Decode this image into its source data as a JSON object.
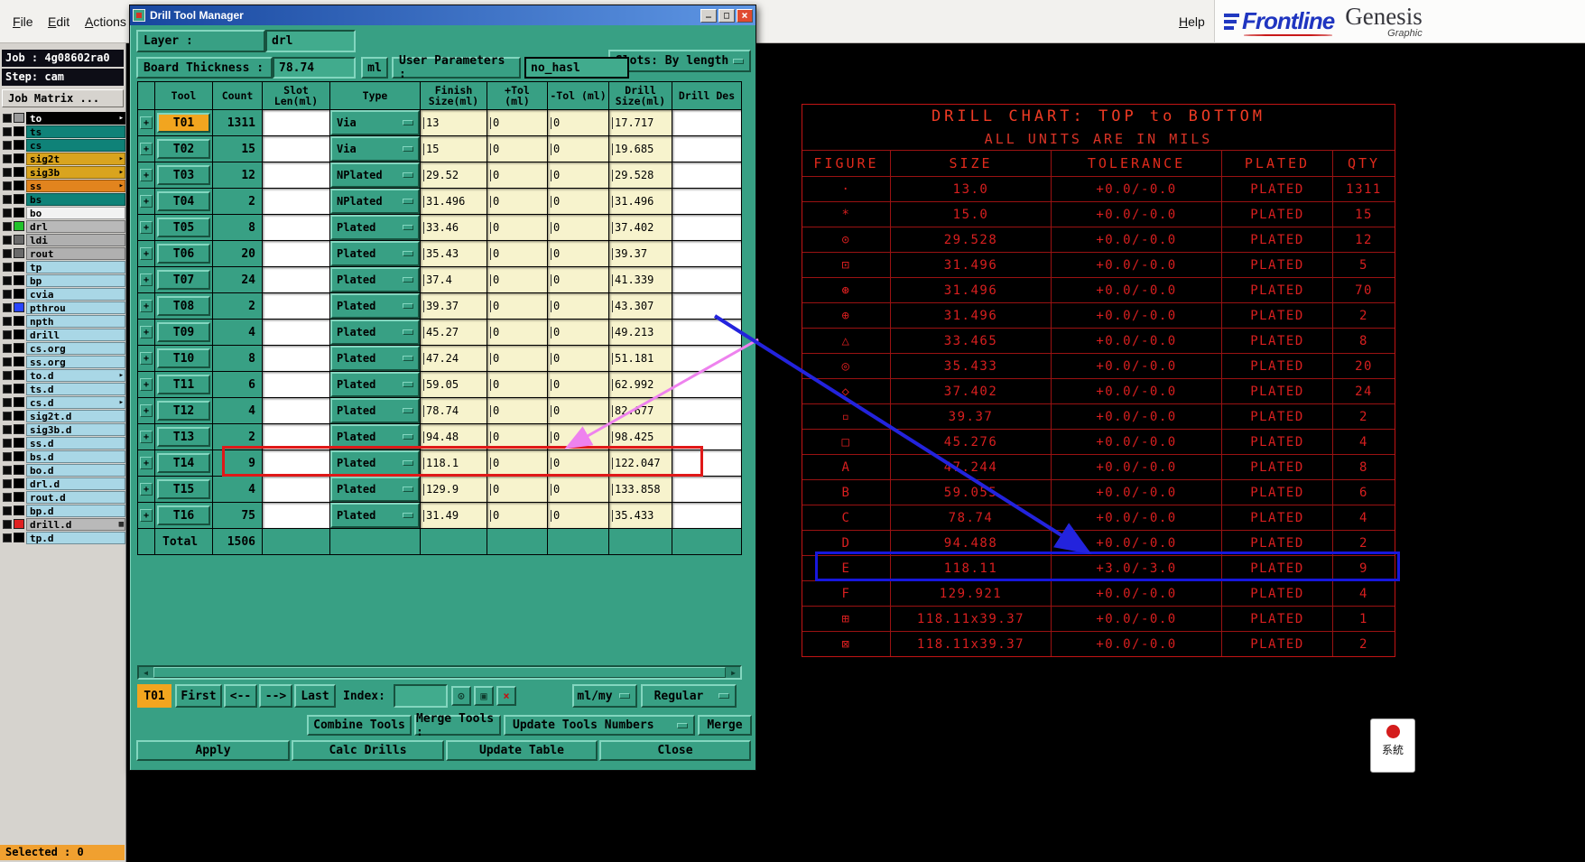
{
  "menubar": {
    "items": [
      "File",
      "Edit",
      "Actions"
    ],
    "help": "Help"
  },
  "logo": {
    "brand": "Frontline",
    "product": "Genesis",
    "subtitle": "Graphic"
  },
  "sidebar": {
    "job_label": "Job : 4g08602ra0",
    "step_label": "Step: cam",
    "job_matrix_button": "Job Matrix ...",
    "selected_label": "Selected : 0",
    "layers": [
      {
        "name": "to",
        "bg": "#000000",
        "fg": "#ffffff",
        "swatch": "#9a9a9a",
        "arrow": true
      },
      {
        "name": "ts",
        "bg": "#0f8278",
        "swatch": "#000000"
      },
      {
        "name": "cs",
        "bg": "#0f8278",
        "swatch": "#000000"
      },
      {
        "name": "sig2t",
        "bg": "#d9a41e",
        "swatch": "#000000",
        "arrow": true
      },
      {
        "name": "sig3b",
        "bg": "#d9a41e",
        "swatch": "#000000",
        "arrow": true
      },
      {
        "name": "ss",
        "bg": "#e2841e",
        "swatch": "#000000",
        "arrow": true
      },
      {
        "name": "bs",
        "bg": "#0f8278",
        "swatch": "#000000"
      },
      {
        "name": "bo",
        "bg": "#f2f2f2",
        "swatch": "#000000"
      },
      {
        "name": "drl",
        "bg": "#b9b9b9",
        "swatch": "#21c22b"
      },
      {
        "name": "ldi",
        "bg": "#b0b0b0",
        "swatch": "#6a6a6a"
      },
      {
        "name": "rout",
        "bg": "#b0b0b0",
        "swatch": "#6a6a6a"
      },
      {
        "name": "tp",
        "bg": "#a9d7e6",
        "swatch": "#000000"
      },
      {
        "name": "bp",
        "bg": "#a9d7e6",
        "swatch": "#000000"
      },
      {
        "name": "cvia",
        "bg": "#a9d7e6",
        "swatch": "#000000"
      },
      {
        "name": "pthrou",
        "bg": "#a9d7e6",
        "swatch": "#2945ff"
      },
      {
        "name": "npth",
        "bg": "#a9d7e6",
        "swatch": "#000000"
      },
      {
        "name": "drill",
        "bg": "#a9d7e6",
        "swatch": "#000000"
      },
      {
        "name": "cs.org",
        "bg": "#a9d7e6",
        "swatch": "#000000"
      },
      {
        "name": "ss.org",
        "bg": "#a9d7e6",
        "swatch": "#000000"
      },
      {
        "name": "to.d",
        "bg": "#a9d7e6",
        "swatch": "#000000",
        "arrow": true
      },
      {
        "name": "ts.d",
        "bg": "#a9d7e6",
        "swatch": "#000000"
      },
      {
        "name": "cs.d",
        "bg": "#a9d7e6",
        "swatch": "#000000",
        "arrow": true
      },
      {
        "name": "sig2t.d",
        "bg": "#a9d7e6",
        "swatch": "#000000"
      },
      {
        "name": "sig3b.d",
        "bg": "#a9d7e6",
        "swatch": "#000000"
      },
      {
        "name": "ss.d",
        "bg": "#a9d7e6",
        "swatch": "#000000"
      },
      {
        "name": "bs.d",
        "bg": "#a9d7e6",
        "swatch": "#000000"
      },
      {
        "name": "bo.d",
        "bg": "#a9d7e6",
        "swatch": "#000000"
      },
      {
        "name": "drl.d",
        "bg": "#a9d7e6",
        "swatch": "#000000"
      },
      {
        "name": "rout.d",
        "bg": "#a9d7e6",
        "swatch": "#000000"
      },
      {
        "name": "bp.d",
        "bg": "#a9d7e6",
        "swatch": "#000000"
      },
      {
        "name": "drill.d",
        "bg": "#b9b9b9",
        "swatch": "#e02020",
        "flag": true
      },
      {
        "name": "tp.d",
        "bg": "#a9d7e6",
        "swatch": "#000000"
      }
    ]
  },
  "dialog": {
    "title": "Drill Tool Manager",
    "layer_label": "Layer :",
    "layer_value": "drl",
    "slots_label": "Slots:",
    "slots_value": "By length",
    "board_thickness_label": "Board Thickness :",
    "board_thickness_value": "78.74",
    "board_thickness_unit": "ml",
    "user_params_label": "User Parameters :",
    "user_params_value": "no_hasl",
    "table": {
      "headers": [
        "Tool",
        "Count",
        "Slot Len(ml)",
        "Type",
        "Finish Size(ml)",
        "+Tol (ml)",
        "-Tol (ml)",
        "Drill Size(ml)",
        "Drill Des"
      ],
      "rows": [
        {
          "tool": "T01",
          "count": "1311",
          "slot_len": "",
          "type": "Via",
          "finish": "13",
          "plus_tol": "0",
          "minus_tol": "0",
          "drill": "17.717",
          "des": "",
          "selected": true
        },
        {
          "tool": "T02",
          "count": "15",
          "slot_len": "",
          "type": "Via",
          "finish": "15",
          "plus_tol": "0",
          "minus_tol": "0",
          "drill": "19.685",
          "des": ""
        },
        {
          "tool": "T03",
          "count": "12",
          "slot_len": "",
          "type": "NPlated",
          "finish": "29.52",
          "plus_tol": "0",
          "minus_tol": "0",
          "drill": "29.528",
          "des": ""
        },
        {
          "tool": "T04",
          "count": "2",
          "slot_len": "",
          "type": "NPlated",
          "finish": "31.496",
          "plus_tol": "0",
          "minus_tol": "0",
          "drill": "31.496",
          "des": ""
        },
        {
          "tool": "T05",
          "count": "8",
          "slot_len": "",
          "type": "Plated",
          "finish": "33.46",
          "plus_tol": "0",
          "minus_tol": "0",
          "drill": "37.402",
          "des": ""
        },
        {
          "tool": "T06",
          "count": "20",
          "slot_len": "",
          "type": "Plated",
          "finish": "35.43",
          "plus_tol": "0",
          "minus_tol": "0",
          "drill": "39.37",
          "des": ""
        },
        {
          "tool": "T07",
          "count": "24",
          "slot_len": "",
          "type": "Plated",
          "finish": "37.4",
          "plus_tol": "0",
          "minus_tol": "0",
          "drill": "41.339",
          "des": ""
        },
        {
          "tool": "T08",
          "count": "2",
          "slot_len": "",
          "type": "Plated",
          "finish": "39.37",
          "plus_tol": "0",
          "minus_tol": "0",
          "drill": "43.307",
          "des": ""
        },
        {
          "tool": "T09",
          "count": "4",
          "slot_len": "",
          "type": "Plated",
          "finish": "45.27",
          "plus_tol": "0",
          "minus_tol": "0",
          "drill": "49.213",
          "des": ""
        },
        {
          "tool": "T10",
          "count": "8",
          "slot_len": "",
          "type": "Plated",
          "finish": "47.24",
          "plus_tol": "0",
          "minus_tol": "0",
          "drill": "51.181",
          "des": ""
        },
        {
          "tool": "T11",
          "count": "6",
          "slot_len": "",
          "type": "Plated",
          "finish": "59.05",
          "plus_tol": "0",
          "minus_tol": "0",
          "drill": "62.992",
          "des": ""
        },
        {
          "tool": "T12",
          "count": "4",
          "slot_len": "",
          "type": "Plated",
          "finish": "78.74",
          "plus_tol": "0",
          "minus_tol": "0",
          "drill": "82.677",
          "des": ""
        },
        {
          "tool": "T13",
          "count": "2",
          "slot_len": "",
          "type": "Plated",
          "finish": "94.48",
          "plus_tol": "0",
          "minus_tol": "0",
          "drill": "98.425",
          "des": ""
        },
        {
          "tool": "T14",
          "count": "9",
          "slot_len": "",
          "type": "Plated",
          "finish": "118.1",
          "plus_tol": "0",
          "minus_tol": "0",
          "drill": "122.047",
          "des": "",
          "highlighted": true
        },
        {
          "tool": "T15",
          "count": "4",
          "slot_len": "",
          "type": "Plated",
          "finish": "129.9",
          "plus_tol": "0",
          "minus_tol": "0",
          "drill": "133.858",
          "des": ""
        },
        {
          "tool": "T16",
          "count": "75",
          "slot_len": "",
          "type": "Plated",
          "finish": "31.49",
          "plus_tol": "0",
          "minus_tol": "0",
          "drill": "35.433",
          "des": ""
        }
      ],
      "total_label": "Total",
      "total_count": "1506"
    },
    "nav": {
      "current": "T01",
      "first": "First",
      "prev": "<--",
      "next": "-->",
      "last": "Last",
      "index_label": "Index:",
      "index_value": "",
      "units": "ml/my",
      "mode": "Regular"
    },
    "tools_row": {
      "combine": "Combine Tools",
      "merge_tools_label": "Merge Tools :",
      "update_numbers": "Update Tools Numbers",
      "merge": "Merge"
    },
    "buttons": {
      "apply": "Apply",
      "calc": "Calc Drills",
      "update": "Update Table",
      "close": "Close"
    }
  },
  "drill_chart": {
    "type": "table",
    "title1": "DRILL CHART: TOP to BOTTOM",
    "title2": "ALL UNITS ARE IN MILS",
    "headers": [
      "FIGURE",
      "SIZE",
      "TOLERANCE",
      "PLATED",
      "QTY"
    ],
    "rows": [
      {
        "figure": "·",
        "size": "13.0",
        "tolerance": "+0.0/-0.0",
        "plated": "PLATED",
        "qty": "1311"
      },
      {
        "figure": "*",
        "size": "15.0",
        "tolerance": "+0.0/-0.0",
        "plated": "PLATED",
        "qty": "15"
      },
      {
        "figure": "⊙",
        "size": "29.528",
        "tolerance": "+0.0/-0.0",
        "plated": "PLATED",
        "qty": "12"
      },
      {
        "figure": "⊡",
        "size": "31.496",
        "tolerance": "+0.0/-0.0",
        "plated": "PLATED",
        "qty": "5"
      },
      {
        "figure": "⊛",
        "size": "31.496",
        "tolerance": "+0.0/-0.0",
        "plated": "PLATED",
        "qty": "70"
      },
      {
        "figure": "⊕",
        "size": "31.496",
        "tolerance": "+0.0/-0.0",
        "plated": "PLATED",
        "qty": "2"
      },
      {
        "figure": "△",
        "size": "33.465",
        "tolerance": "+0.0/-0.0",
        "plated": "PLATED",
        "qty": "8"
      },
      {
        "figure": "◎",
        "size": "35.433",
        "tolerance": "+0.0/-0.0",
        "plated": "PLATED",
        "qty": "20"
      },
      {
        "figure": "◇",
        "size": "37.402",
        "tolerance": "+0.0/-0.0",
        "plated": "PLATED",
        "qty": "24"
      },
      {
        "figure": "▫",
        "size": "39.37",
        "tolerance": "+0.0/-0.0",
        "plated": "PLATED",
        "qty": "2"
      },
      {
        "figure": "□",
        "size": "45.276",
        "tolerance": "+0.0/-0.0",
        "plated": "PLATED",
        "qty": "4"
      },
      {
        "figure": "A",
        "size": "47.244",
        "tolerance": "+0.0/-0.0",
        "plated": "PLATED",
        "qty": "8"
      },
      {
        "figure": "B",
        "size": "59.055",
        "tolerance": "+0.0/-0.0",
        "plated": "PLATED",
        "qty": "6"
      },
      {
        "figure": "C",
        "size": "78.74",
        "tolerance": "+0.0/-0.0",
        "plated": "PLATED",
        "qty": "4"
      },
      {
        "figure": "D",
        "size": "94.488",
        "tolerance": "+0.0/-0.0",
        "plated": "PLATED",
        "qty": "2"
      },
      {
        "figure": "E",
        "size": "118.11",
        "tolerance": "+3.0/-3.0",
        "plated": "PLATED",
        "qty": "9",
        "highlighted": true
      },
      {
        "figure": "F",
        "size": "129.921",
        "tolerance": "+0.0/-0.0",
        "plated": "PLATED",
        "qty": "4"
      },
      {
        "figure": "⊞",
        "size": "118.11x39.37",
        "tolerance": "+0.0/-0.0",
        "plated": "PLATED",
        "qty": "1"
      },
      {
        "figure": "⊠",
        "size": "118.11x39.37",
        "tolerance": "+0.0/-0.0",
        "plated": "PLATED",
        "qty": "2"
      }
    ]
  },
  "popup": {
    "label": "系統"
  },
  "colors": {
    "dialog_teal": "#38a084",
    "field_yellow": "#f7f3cd",
    "selected_orange": "#f2a51f",
    "chart_red": "#d81f1f",
    "highlight_red": "#e01818",
    "highlight_blue": "#1717dd",
    "arrow_pink": "#ee82ee",
    "arrow_blue": "#2323dd"
  }
}
